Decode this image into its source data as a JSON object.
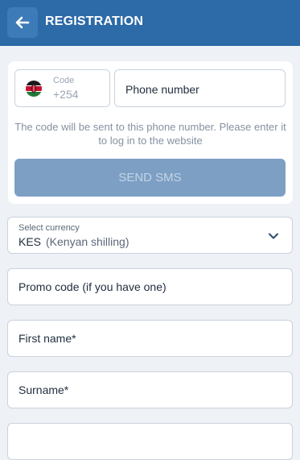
{
  "header": {
    "title": "REGISTRATION",
    "back_icon": "arrow-left-icon",
    "background_color": "#2c6aa8"
  },
  "phone_card": {
    "code_label": "Code",
    "code_value": "+254",
    "flag_icon": "kenya-flag-icon",
    "phone_placeholder": "Phone number",
    "hint": "The code will be sent to this phone number. Please enter it to log in to the website",
    "send_button": "SEND SMS"
  },
  "currency": {
    "label": "Select currency",
    "code": "KES",
    "name": "(Kenyan shilling)",
    "dropdown_icon": "chevron-down-icon"
  },
  "fields": {
    "promo": "Promo code (if you have one)",
    "first_name": "First name*",
    "surname": "Surname*"
  }
}
